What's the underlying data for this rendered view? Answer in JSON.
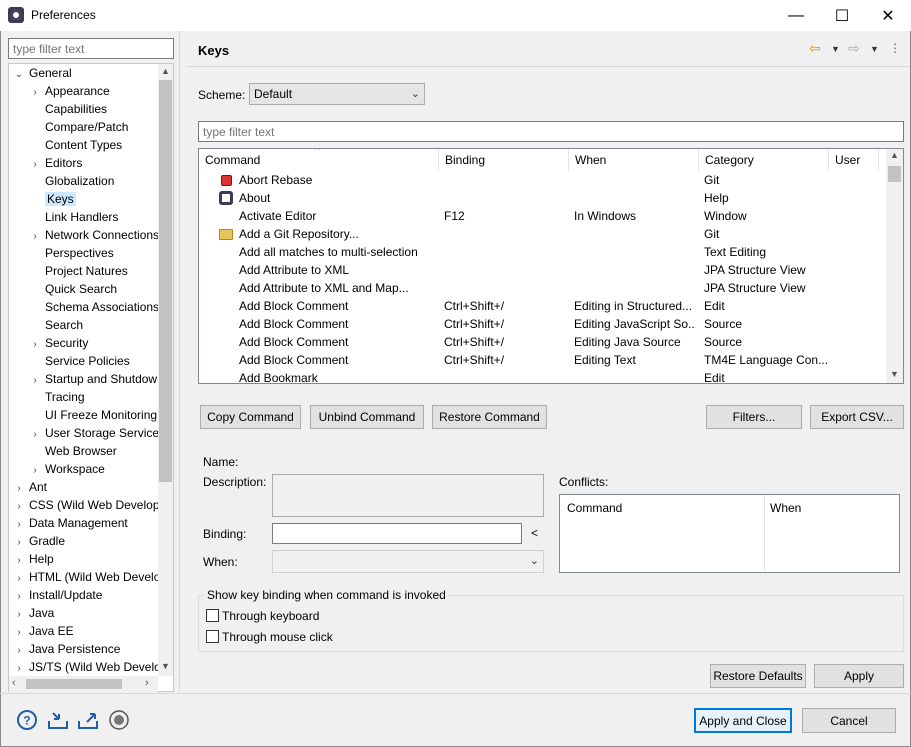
{
  "window": {
    "title": "Preferences",
    "minimize": "—",
    "maximize": "☐",
    "close": "✕"
  },
  "sidebar": {
    "filter_placeholder": "type filter text",
    "items": [
      {
        "label": "General",
        "chev": "⌄",
        "indent": 0,
        "expanded": true
      },
      {
        "label": "Appearance",
        "chev": "›",
        "indent": 1
      },
      {
        "label": "Capabilities",
        "chev": "",
        "indent": 1
      },
      {
        "label": "Compare/Patch",
        "chev": "",
        "indent": 1
      },
      {
        "label": "Content Types",
        "chev": "",
        "indent": 1
      },
      {
        "label": "Editors",
        "chev": "›",
        "indent": 1
      },
      {
        "label": "Globalization",
        "chev": "",
        "indent": 1
      },
      {
        "label": "Keys",
        "chev": "",
        "indent": 1,
        "selected": true
      },
      {
        "label": "Link Handlers",
        "chev": "",
        "indent": 1
      },
      {
        "label": "Network Connections",
        "chev": "›",
        "indent": 1
      },
      {
        "label": "Perspectives",
        "chev": "",
        "indent": 1
      },
      {
        "label": "Project Natures",
        "chev": "",
        "indent": 1
      },
      {
        "label": "Quick Search",
        "chev": "",
        "indent": 1
      },
      {
        "label": "Schema Associations",
        "chev": "",
        "indent": 1
      },
      {
        "label": "Search",
        "chev": "",
        "indent": 1
      },
      {
        "label": "Security",
        "chev": "›",
        "indent": 1
      },
      {
        "label": "Service Policies",
        "chev": "",
        "indent": 1
      },
      {
        "label": "Startup and Shutdown",
        "chev": "›",
        "indent": 1
      },
      {
        "label": "Tracing",
        "chev": "",
        "indent": 1
      },
      {
        "label": "UI Freeze Monitoring",
        "chev": "",
        "indent": 1
      },
      {
        "label": "User Storage Service",
        "chev": "›",
        "indent": 1
      },
      {
        "label": "Web Browser",
        "chev": "",
        "indent": 1
      },
      {
        "label": "Workspace",
        "chev": "›",
        "indent": 1
      },
      {
        "label": "Ant",
        "chev": "›",
        "indent": 0
      },
      {
        "label": "CSS (Wild Web Developer)",
        "chev": "›",
        "indent": 0
      },
      {
        "label": "Data Management",
        "chev": "›",
        "indent": 0
      },
      {
        "label": "Gradle",
        "chev": "›",
        "indent": 0
      },
      {
        "label": "Help",
        "chev": "›",
        "indent": 0
      },
      {
        "label": "HTML (Wild Web Developer)",
        "chev": "›",
        "indent": 0
      },
      {
        "label": "Install/Update",
        "chev": "›",
        "indent": 0
      },
      {
        "label": "Java",
        "chev": "›",
        "indent": 0
      },
      {
        "label": "Java EE",
        "chev": "›",
        "indent": 0
      },
      {
        "label": "Java Persistence",
        "chev": "›",
        "indent": 0
      },
      {
        "label": "JS/TS (Wild Web Developer)",
        "chev": "›",
        "indent": 0
      }
    ]
  },
  "main": {
    "title": "Keys",
    "scheme_label": "Scheme:",
    "scheme_value": "Default",
    "filter_placeholder": "type filter text",
    "columns": [
      "Command",
      "Binding",
      "When",
      "Category",
      "User"
    ],
    "rows": [
      {
        "icon": "stop-icon",
        "command": "Abort Rebase",
        "binding": "",
        "when": "",
        "category": "Git",
        "user": ""
      },
      {
        "icon": "eclipse-icon",
        "command": "About",
        "binding": "",
        "when": "",
        "category": "Help",
        "user": ""
      },
      {
        "icon": "",
        "command": "Activate Editor",
        "binding": "F12",
        "when": "In Windows",
        "category": "Window",
        "user": ""
      },
      {
        "icon": "folder-icon",
        "command": "Add a Git Repository...",
        "binding": "",
        "when": "",
        "category": "Git",
        "user": ""
      },
      {
        "icon": "",
        "command": "Add all matches to multi-selection",
        "binding": "",
        "when": "",
        "category": "Text Editing",
        "user": ""
      },
      {
        "icon": "",
        "command": "Add Attribute to XML",
        "binding": "",
        "when": "",
        "category": "JPA Structure View",
        "user": ""
      },
      {
        "icon": "",
        "command": "Add Attribute to XML and Map...",
        "binding": "",
        "when": "",
        "category": "JPA Structure View",
        "user": ""
      },
      {
        "icon": "",
        "command": "Add Block Comment",
        "binding": "Ctrl+Shift+/",
        "when": "Editing in Structured...",
        "category": "Edit",
        "user": ""
      },
      {
        "icon": "",
        "command": "Add Block Comment",
        "binding": "Ctrl+Shift+/",
        "when": "Editing JavaScript So...",
        "category": "Source",
        "user": ""
      },
      {
        "icon": "",
        "command": "Add Block Comment",
        "binding": "Ctrl+Shift+/",
        "when": "Editing Java Source",
        "category": "Source",
        "user": ""
      },
      {
        "icon": "",
        "command": "Add Block Comment",
        "binding": "Ctrl+Shift+/",
        "when": "Editing Text",
        "category": "TM4E Language Con...",
        "user": ""
      },
      {
        "icon": "",
        "command": "Add Bookmark",
        "binding": "",
        "when": "",
        "category": "Edit",
        "user": ""
      }
    ],
    "copy_command": "Copy Command",
    "unbind_command": "Unbind Command",
    "restore_command": "Restore Command",
    "filters": "Filters...",
    "export_csv": "Export CSV...",
    "name_label": "Name:",
    "description_label": "Description:",
    "binding_label": "Binding:",
    "when_label": "When:",
    "conflicts_label": "Conflicts:",
    "conflicts_columns": [
      "Command",
      "When"
    ],
    "show_group_label": "Show key binding when command is invoked",
    "through_keyboard": "Through keyboard",
    "through_mouse": "Through mouse click",
    "binding_arrow": "<",
    "restore_defaults": "Restore Defaults",
    "apply": "Apply"
  },
  "footer": {
    "apply_and_close": "Apply and Close",
    "cancel": "Cancel"
  },
  "colors": {
    "selection": "#cce8ff",
    "accent": "#0078d7"
  }
}
